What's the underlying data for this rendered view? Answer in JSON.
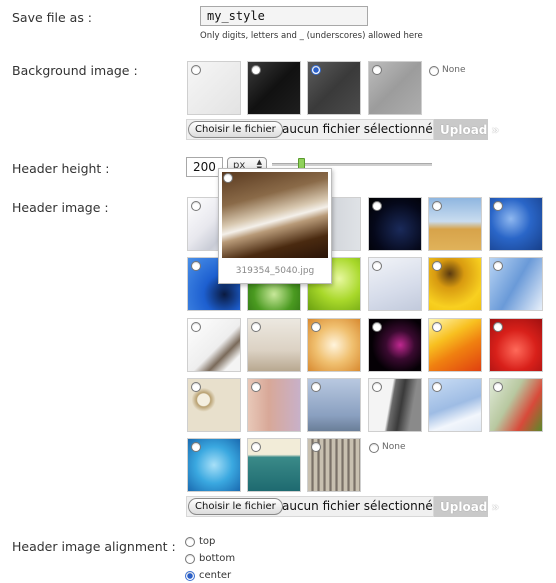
{
  "save_file": {
    "label": "Save file as :",
    "value": "my_style",
    "hint": "Only digits, letters and _ (underscores) allowed here"
  },
  "background_image": {
    "label": "Background image :",
    "none_label": "None",
    "selected_index": 2
  },
  "file_upload": {
    "choose_label": "Choisir le fichier",
    "no_file_label": "aucun fichier sélectionné",
    "upload_label": "Upload »"
  },
  "header_height": {
    "label": "Header height :",
    "value": "200",
    "unit": "px"
  },
  "header_image": {
    "label": "Header image :",
    "none_label": "None",
    "preview_filename": "319354_5040.jpg"
  },
  "header_image_alignment": {
    "label": "Header image alignment :",
    "options": [
      "top",
      "bottom",
      "center"
    ],
    "selected": "center"
  },
  "colors": {
    "upload_bg": "#c9c9c9",
    "radio_selected": "#2a5fc8"
  }
}
